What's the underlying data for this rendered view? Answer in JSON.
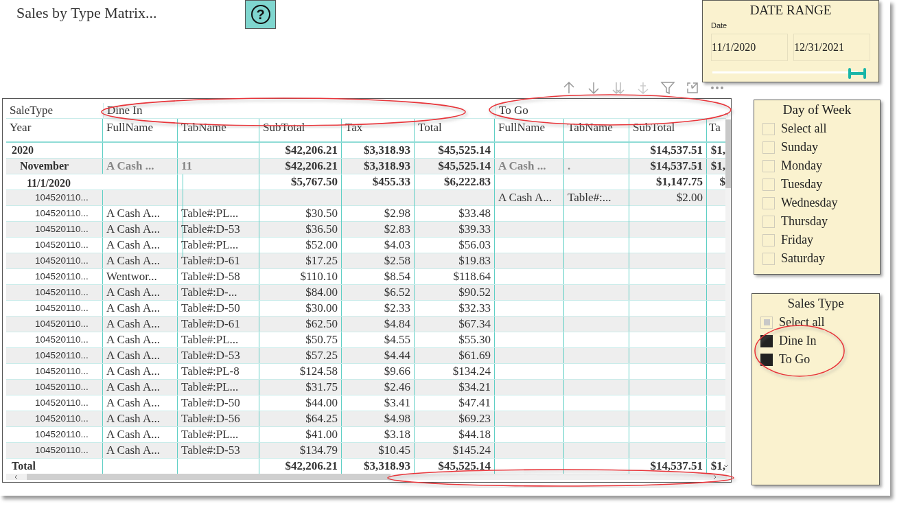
{
  "report": {
    "title": "Sales by Type Matrix...",
    "help_button": "?"
  },
  "matrix": {
    "corner_group_label": "SaleType",
    "row_header": "Year",
    "groups": [
      {
        "label": "Dine In",
        "columns": [
          "FullName",
          "TabName",
          "SubTotal",
          "Tax",
          "Total"
        ]
      },
      {
        "label": "To Go",
        "columns": [
          "FullName",
          "TabName",
          "SubTotal",
          "Ta"
        ]
      }
    ],
    "rows": [
      {
        "kind": "year",
        "label": "2020",
        "cells": [
          null,
          null,
          "$42,206.21",
          "$3,318.93",
          "$45,525.14",
          null,
          null,
          "$14,537.51",
          "$1,"
        ]
      },
      {
        "kind": "month",
        "label": "November",
        "cells": [
          "A Cash ...",
          "11",
          "$42,206.21",
          "$3,318.93",
          "$45,525.14",
          "A Cash ...",
          ".",
          "$14,537.51",
          "$1,"
        ]
      },
      {
        "kind": "date",
        "label": "11/1/2020",
        "cells": [
          null,
          null,
          "$5,767.50",
          "$455.33",
          "$6,222.83",
          null,
          null,
          "$1,147.75",
          "$"
        ]
      },
      {
        "kind": "detail",
        "label": "104520110...",
        "cells": [
          null,
          null,
          null,
          null,
          null,
          "A Cash A...",
          "Table#:...",
          "$2.00",
          null
        ]
      },
      {
        "kind": "detail",
        "label": "104520110...",
        "cells": [
          "A Cash A...",
          "Table#:PL...",
          "$30.50",
          "$2.98",
          "$33.48",
          null,
          null,
          null,
          null
        ]
      },
      {
        "kind": "detail",
        "label": "104520110...",
        "cells": [
          "A Cash A...",
          "Table#:D-53",
          "$36.50",
          "$2.83",
          "$39.33",
          null,
          null,
          null,
          null
        ]
      },
      {
        "kind": "detail",
        "label": "104520110...",
        "cells": [
          "A Cash A...",
          "Table#:PL...",
          "$52.00",
          "$4.03",
          "$56.03",
          null,
          null,
          null,
          null
        ]
      },
      {
        "kind": "detail",
        "label": "104520110...",
        "cells": [
          "A Cash A...",
          "Table#:D-61",
          "$17.25",
          "$2.58",
          "$19.83",
          null,
          null,
          null,
          null
        ]
      },
      {
        "kind": "detail",
        "label": "104520110...",
        "cells": [
          "Wentwor...",
          "Table#:D-58",
          "$110.10",
          "$8.54",
          "$118.64",
          null,
          null,
          null,
          null
        ]
      },
      {
        "kind": "detail",
        "label": "104520110...",
        "cells": [
          "A Cash A...",
          "Table#:D-...",
          "$84.00",
          "$6.52",
          "$90.52",
          null,
          null,
          null,
          null
        ]
      },
      {
        "kind": "detail",
        "label": "104520110...",
        "cells": [
          "A Cash A...",
          "Table#:D-50",
          "$30.00",
          "$2.33",
          "$32.33",
          null,
          null,
          null,
          null
        ]
      },
      {
        "kind": "detail",
        "label": "104520110...",
        "cells": [
          "A Cash A...",
          "Table#:D-61",
          "$62.50",
          "$4.84",
          "$67.34",
          null,
          null,
          null,
          null
        ]
      },
      {
        "kind": "detail",
        "label": "104520110...",
        "cells": [
          "A Cash A...",
          "Table#:PL...",
          "$50.75",
          "$4.55",
          "$55.30",
          null,
          null,
          null,
          null
        ]
      },
      {
        "kind": "detail",
        "label": "104520110...",
        "cells": [
          "A Cash A...",
          "Table#:D-53",
          "$57.25",
          "$4.44",
          "$61.69",
          null,
          null,
          null,
          null
        ]
      },
      {
        "kind": "detail",
        "label": "104520110...",
        "cells": [
          "A Cash A...",
          "Table#:PL-8",
          "$124.58",
          "$9.66",
          "$134.24",
          null,
          null,
          null,
          null
        ]
      },
      {
        "kind": "detail",
        "label": "104520110...",
        "cells": [
          "A Cash A...",
          "Table#:PL...",
          "$31.75",
          "$2.46",
          "$34.21",
          null,
          null,
          null,
          null
        ]
      },
      {
        "kind": "detail",
        "label": "104520110...",
        "cells": [
          "A Cash A...",
          "Table#:D-50",
          "$44.00",
          "$3.41",
          "$47.41",
          null,
          null,
          null,
          null
        ]
      },
      {
        "kind": "detail",
        "label": "104520110...",
        "cells": [
          "A Cash A...",
          "Table#:D-56",
          "$64.25",
          "$4.98",
          "$69.23",
          null,
          null,
          null,
          null
        ]
      },
      {
        "kind": "detail",
        "label": "104520110...",
        "cells": [
          "A Cash A...",
          "Table#:PL...",
          "$41.00",
          "$3.18",
          "$44.18",
          null,
          null,
          null,
          null
        ]
      },
      {
        "kind": "detail",
        "label": "104520110...",
        "cells": [
          "A Cash A...",
          "Table#:D-53",
          "$134.79",
          "$10.45",
          "$145.24",
          null,
          null,
          null,
          null
        ]
      },
      {
        "kind": "total",
        "label": "Total",
        "cells": [
          null,
          null,
          "$42,206.21",
          "$3,318.93",
          "$45,525.14",
          null,
          null,
          "$14,537.51",
          "$1,"
        ]
      }
    ]
  },
  "date_slicer": {
    "title": "DATE RANGE",
    "label": "Date",
    "from": "11/1/2020",
    "to": "12/31/2021",
    "level": 0.92
  },
  "day_of_week_slicer": {
    "title": "Day of Week",
    "items": [
      {
        "label": "Select all",
        "checked": false,
        "indeterminate": false
      },
      {
        "label": "Sunday",
        "checked": false,
        "indeterminate": false
      },
      {
        "label": "Monday",
        "checked": false,
        "indeterminate": false
      },
      {
        "label": "Tuesday",
        "checked": false,
        "indeterminate": false
      },
      {
        "label": "Wednesday",
        "checked": false,
        "indeterminate": false
      },
      {
        "label": "Thursday",
        "checked": false,
        "indeterminate": false
      },
      {
        "label": "Friday",
        "checked": false,
        "indeterminate": false
      },
      {
        "label": "Saturday",
        "checked": false,
        "indeterminate": false
      }
    ]
  },
  "sales_type_slicer": {
    "title": "Sales Type",
    "items": [
      {
        "label": "Select all",
        "checked": false,
        "indeterminate": true
      },
      {
        "label": "Dine In",
        "checked": true,
        "indeterminate": false
      },
      {
        "label": "To Go",
        "checked": true,
        "indeterminate": false
      }
    ]
  }
}
